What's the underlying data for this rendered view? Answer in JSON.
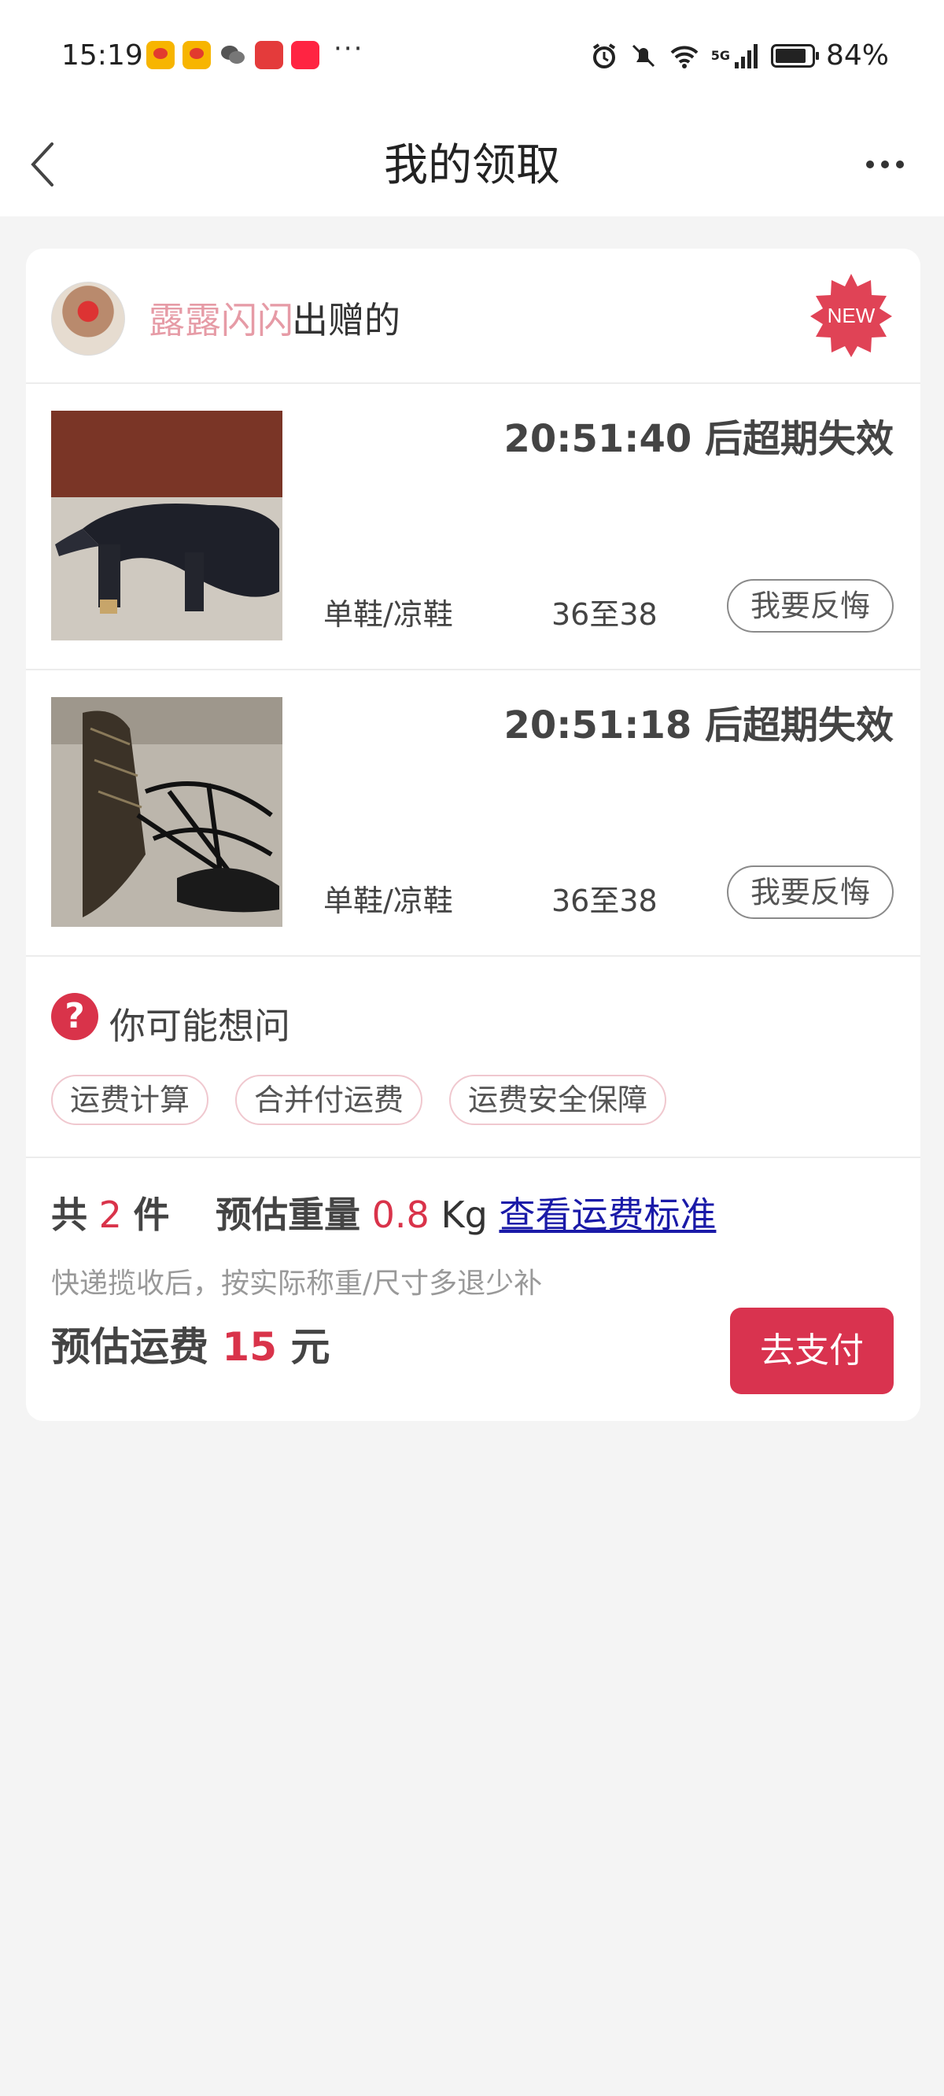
{
  "status_bar": {
    "time": "15:19",
    "more": "···",
    "network": "5G",
    "battery": "84%"
  },
  "header": {
    "title": "我的领取"
  },
  "giver": {
    "name": "露露闪闪",
    "suffix": "出赠的",
    "badge": "NEW"
  },
  "items": [
    {
      "countdown": "20:51:40 后超期失效",
      "category": "单鞋/凉鞋",
      "size": "36至38",
      "action": "我要反悔"
    },
    {
      "countdown": "20:51:18 后超期失效",
      "category": "单鞋/凉鞋",
      "size": "36至38",
      "action": "我要反悔"
    }
  ],
  "faq": {
    "icon": "?",
    "title": "你可能想问",
    "chips": [
      "运费计算",
      "合并付运费",
      "运费安全保障"
    ]
  },
  "summary": {
    "total_prefix": "共",
    "count": "2",
    "count_unit": "件",
    "weight_label": "预估重量",
    "weight_value": "0.8",
    "weight_unit": "Kg",
    "standard_link": "查看运费标准",
    "note": "快递揽收后，按实际称重/尺寸多退少补",
    "fee_label": "预估运费",
    "fee_value": "15",
    "fee_unit": "元",
    "pay_button": "去支付"
  },
  "colors": {
    "accent": "#d9334f",
    "giver_name": "#e69ba6",
    "link": "#1a1aa8",
    "background": "#f4f4f4"
  }
}
